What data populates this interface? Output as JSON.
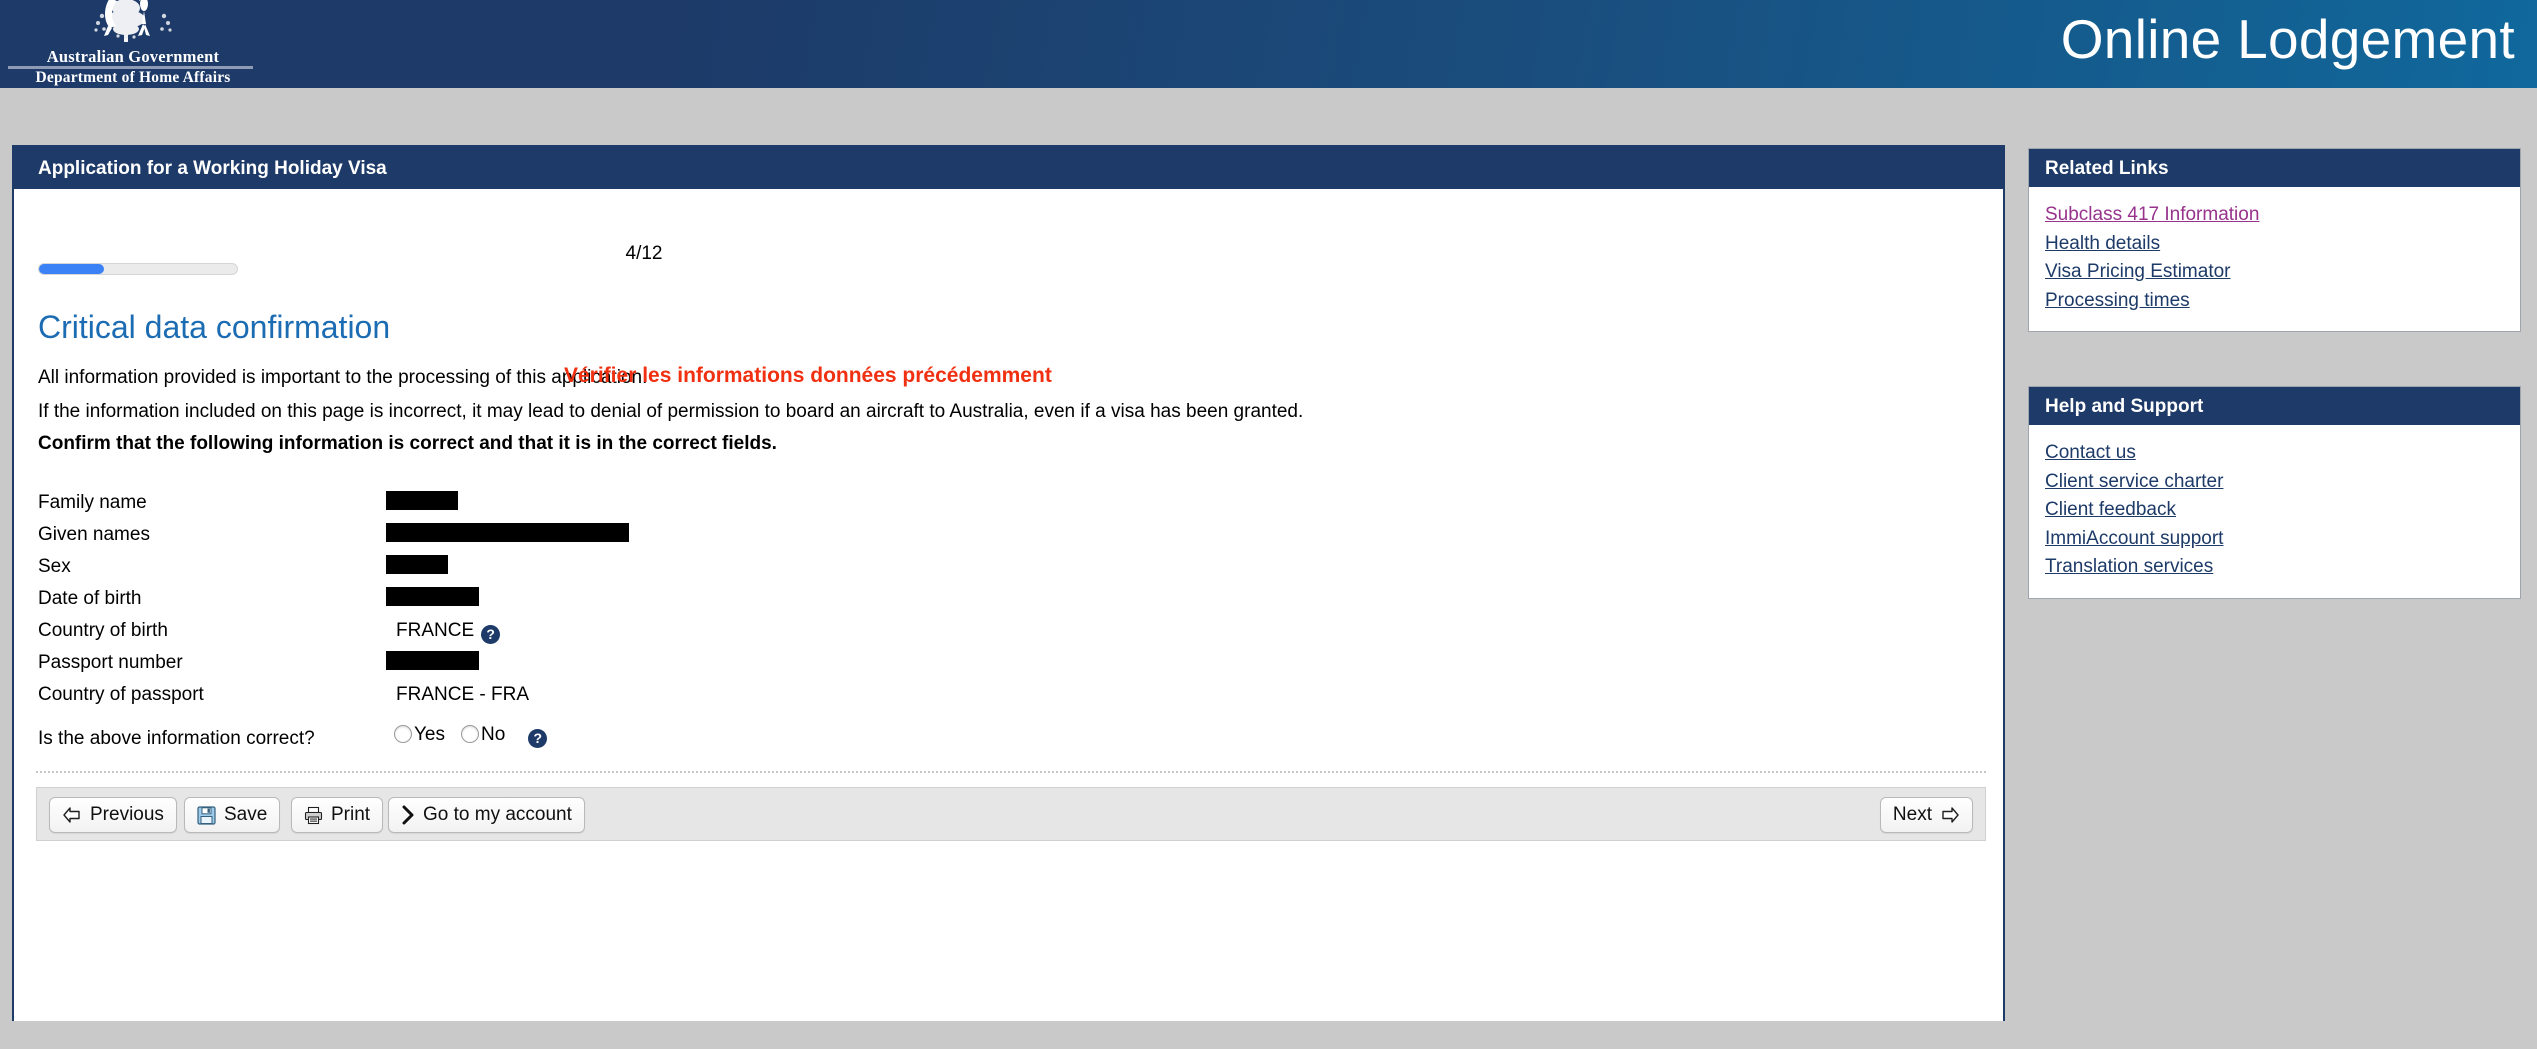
{
  "header": {
    "crest_line1": "Australian Government",
    "crest_line2": "Department of Home Affairs",
    "title": "Online Lodgement"
  },
  "panel": {
    "title": "Application for a Working Holiday Visa",
    "page_counter": "4/12",
    "progress_percent": 33,
    "section_heading": "Critical data confirmation",
    "intro_line": "All information provided is important to the processing of this application.",
    "french_note": "Vérifier les informations données précédemment",
    "warning_line": "If the information included on this page is incorrect, it may lead to denial of permission to board an aircraft to Australia, even if a visa has been granted.",
    "confirm_line": "Confirm that the following information is correct and that it is in the correct fields."
  },
  "fields": [
    {
      "label": "Family name",
      "value": "",
      "redacted": true,
      "redact_width": 72,
      "help": false
    },
    {
      "label": "Given names",
      "value": "",
      "redacted": true,
      "redact_width": 243,
      "help": false
    },
    {
      "label": "Sex",
      "value": "",
      "redacted": true,
      "redact_width": 62,
      "help": false
    },
    {
      "label": "Date of birth",
      "value": "",
      "redacted": true,
      "redact_width": 93,
      "help": false
    },
    {
      "label": "Country of birth",
      "value": "FRANCE",
      "redacted": false,
      "redact_width": 0,
      "help": true
    },
    {
      "label": "Passport number",
      "value": "",
      "redacted": true,
      "redact_width": 93,
      "help": false
    },
    {
      "label": "Country of passport",
      "value": "FRANCE - FRA",
      "redacted": false,
      "redact_width": 0,
      "help": false
    }
  ],
  "confirm_question": {
    "question": "Is the above information correct?",
    "yes_label": "Yes",
    "no_label": "No",
    "yes_selected": false,
    "no_selected": false,
    "help": true
  },
  "toolbar": {
    "previous_label": "Previous",
    "save_label": "Save",
    "print_label": "Print",
    "account_label": "Go to my account",
    "next_label": "Next"
  },
  "sidebar": {
    "related_links": {
      "title": "Related Links",
      "links": [
        {
          "label": "Subclass 417 Information",
          "visited": true
        },
        {
          "label": "Health details",
          "visited": false
        },
        {
          "label": "Visa Pricing Estimator",
          "visited": false
        },
        {
          "label": "Processing times",
          "visited": false
        }
      ]
    },
    "help_support": {
      "title": "Help and Support",
      "links": [
        {
          "label": "Contact us",
          "visited": false
        },
        {
          "label": "Client service charter",
          "visited": false
        },
        {
          "label": "Client feedback",
          "visited": false
        },
        {
          "label": "ImmiAccount support",
          "visited": false
        },
        {
          "label": "Translation services",
          "visited": false
        }
      ]
    }
  },
  "colors": {
    "navy": "#1d3a68",
    "header_blue_right": "#10689c",
    "heading_blue": "#1b6cb3",
    "alert_red": "#f03010",
    "progress_blue": "#3b82f6",
    "visited_link": "#97338c",
    "page_background": "#c9c9c9"
  }
}
